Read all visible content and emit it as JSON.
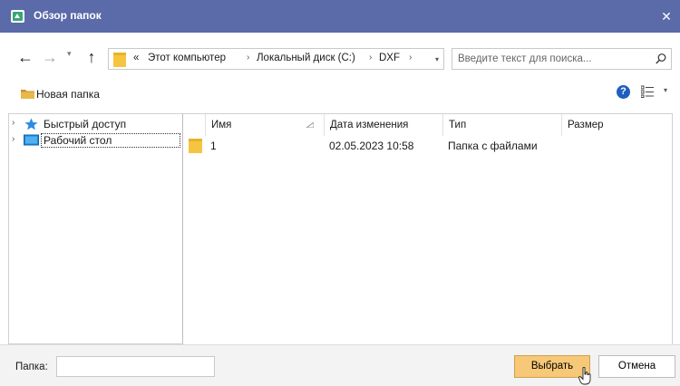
{
  "window": {
    "title": "Обзор папок",
    "close_glyph": "✕"
  },
  "nav": {
    "back_glyph": "←",
    "forward_glyph": "→",
    "recent_glyph": "▾",
    "up_glyph": "↑"
  },
  "address": {
    "overflow_glyph": "«",
    "crumbs": [
      "Этот компьютер",
      "Локальный диск (C:)",
      "DXF"
    ],
    "separator_glyph": "›",
    "dropdown_glyph": "▾"
  },
  "search": {
    "placeholder": "Введите текст для поиска..."
  },
  "toolbar": {
    "new_folder_label": "Новая папка",
    "help_glyph": "?",
    "view_dropdown_glyph": "▾"
  },
  "tree": {
    "expand_glyph": "›",
    "items": [
      {
        "label": "Быстрый доступ"
      },
      {
        "label": "Рабочий стол"
      }
    ]
  },
  "table": {
    "columns": [
      "Имя",
      "Дата изменения",
      "Тип",
      "Размер"
    ],
    "rows": [
      {
        "name": "1",
        "date": "02.05.2023 10:58",
        "type": "Папка с файлами",
        "size": ""
      }
    ]
  },
  "footer": {
    "folder_label": "Папка:",
    "folder_value": "",
    "select_label": "Выбрать",
    "cancel_label": "Отмена"
  },
  "colors": {
    "titlebar": "#5b6aa8",
    "primary_button": "#f6c877",
    "folder": "#f5c542",
    "accent_blue": "#1f5fbf"
  },
  "icons": [
    "app-icon",
    "close-icon",
    "back-arrow-icon",
    "forward-arrow-icon",
    "up-arrow-icon",
    "folder-icon",
    "search-icon",
    "new-folder-icon",
    "help-icon",
    "view-options-icon",
    "star-icon",
    "desktop-icon",
    "sort-icon",
    "cursor-icon"
  ]
}
